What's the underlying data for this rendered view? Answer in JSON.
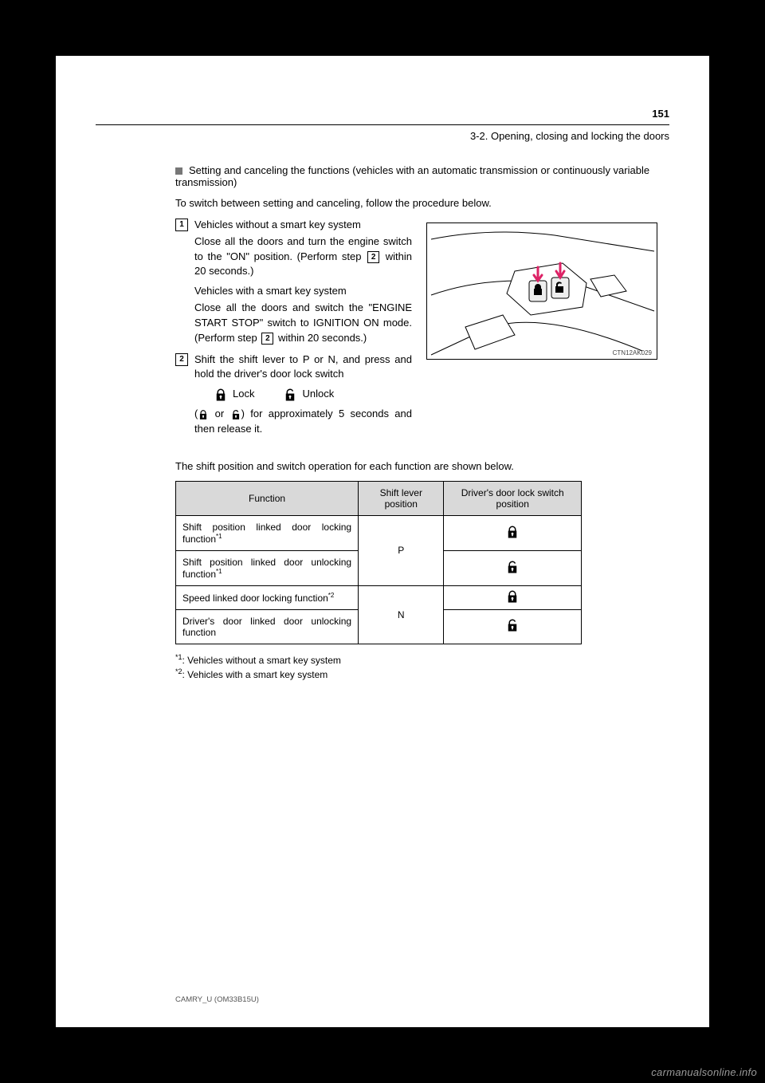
{
  "header": {
    "page_number": "151",
    "section_path": "3-2. Opening, closing and locking the doors"
  },
  "subhead": "Setting and canceling the functions (vehicles with an automatic transmission or continuously variable transmission)",
  "intro_para": "To switch between setting and canceling, follow the procedure below.",
  "steps": {
    "s1_label": "1",
    "s1_text_a": "Close all the doors and turn the engine switch to the \"ON\" position. (Perform step ",
    "s1_text_b": " within 20 seconds.)",
    "s1_text_alt_a": "Close all the doors and switch the \"ENGINE START STOP\" switch to IGNITION ON mode. (Perform step ",
    "s1_text_alt_b": " within 20 seconds.)",
    "inline_ref": "2",
    "s2_label": "2",
    "s2_text": "Shift the shift lever to P or N, and press and hold the driver's door lock switch",
    "lock_label": "Lock",
    "unlock_label": "Unlock",
    "s2_text_tail": "( or ) for approximately 5 seconds and then release it.",
    "s2_text_pre": "(",
    "s2_text_or": " or ",
    "s2_text_post": ") for approximately 5 seconds and then release it."
  },
  "table_intro": "The shift position and switch operation for each function are shown below.",
  "table": {
    "headers": [
      "Function",
      "Shift lever position",
      "Driver's door lock switch position"
    ],
    "rows": [
      {
        "fn": "Shift position linked door locking function",
        "fn_sup": "*1",
        "shift": "P",
        "icon": "lock"
      },
      {
        "fn": "Shift position linked door unlocking function",
        "fn_sup": "*1",
        "shift": "P",
        "icon": "unlock"
      },
      {
        "fn": "Speed linked door locking function",
        "fn_sup": "*2",
        "shift": "N",
        "icon": "lock"
      },
      {
        "fn": "Driver's door linked door unlocking function",
        "fn_sup": "",
        "shift": "N",
        "icon": "unlock"
      }
    ]
  },
  "footnotes": {
    "f1_sup": "*1",
    "f1": ": Vehicles without a smart key system",
    "f2_sup": "*2",
    "f2": ": Vehicles with a smart key system"
  },
  "diagram_ref": "CTN12AK029",
  "bottom_note": "CAMRY_U (OM33B15U)",
  "watermark": "carmanualsonline.info"
}
